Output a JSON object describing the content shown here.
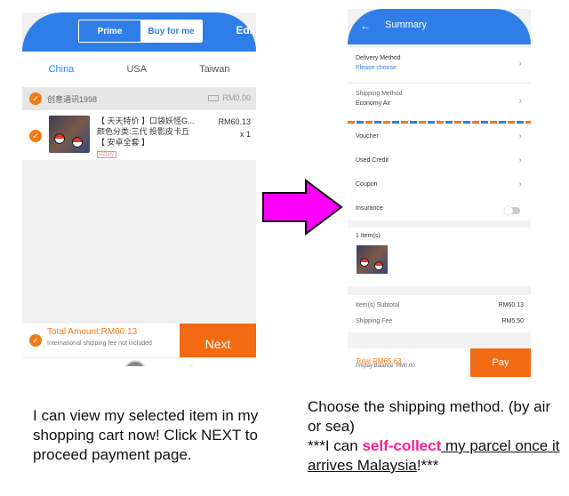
{
  "left_phone": {
    "segment": {
      "prime": "Prime",
      "buy_for_me": "Buy for me"
    },
    "edit_label": "Edi",
    "tabs": [
      "China",
      "USA",
      "Taiwan"
    ],
    "store": {
      "name": "创意通讯1998",
      "shipping": "RM0.00"
    },
    "item": {
      "title_line1": "【 天天特价 】口袋妖怪G...",
      "title_line2": "颜色分类:三代 投影皮卡丘",
      "title_line3": "【 安卓全套 】",
      "tag": "ezbuy",
      "price": "RM60.13",
      "qty": "x 1"
    },
    "footer": {
      "total": "Total Amount:RM60.13",
      "note": "International shipping fee not included",
      "next": "Next"
    }
  },
  "right_phone": {
    "title": "Summary",
    "delivery": {
      "label": "Delivery Method",
      "value": "Please choose"
    },
    "shipping": {
      "label": "Shipping Method",
      "value": "Economy Air"
    },
    "voucher": "Voucher",
    "used_credit": "Used Credit",
    "coupon": "Coupon",
    "insurance": "Insurance",
    "items_count": "1 Item(s)",
    "subtotal_label": "Item(s) Subtotal",
    "subtotal_value": "RM60.13",
    "fee_label": "Shipping Fee",
    "fee_value": "RM5.50",
    "total": "Total RM65.63",
    "balance": "Prepay Balance: RM0.00",
    "pay": "Pay"
  },
  "captions": {
    "left": "I can view my selected item in my shopping cart now! Click NEXT to proceed payment page.",
    "right_1": "Choose the shipping method. (by air or sea)",
    "right_2a": "***I can ",
    "right_2b": "self-collect",
    "right_2c": " my parcel once it arrives Malaysia",
    "right_2d": "!***"
  },
  "colors": {
    "brand_blue": "#2f7ee8",
    "accent_orange": "#f26a12",
    "arrow_magenta": "#ff00ff",
    "highlight_pink": "#ff1f8f"
  }
}
